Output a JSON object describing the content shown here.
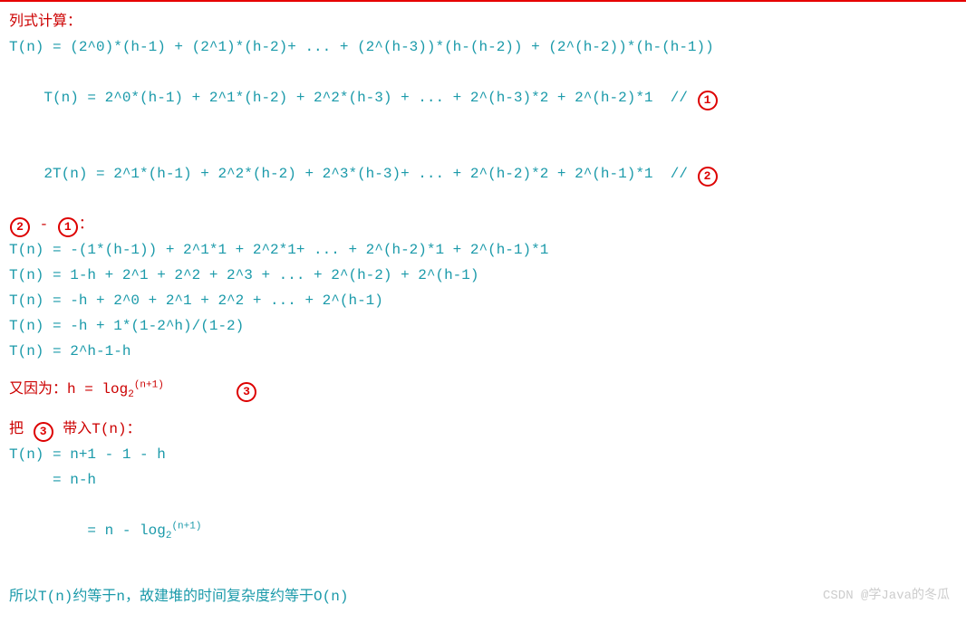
{
  "heading": "列式计算：",
  "eq1": "T(n) = (2^0)*(h-1) + (2^1)*(h-2)+ ... + (2^(h-3))*(h-(h-2)) + (2^(h-2))*(h-(h-1))",
  "eq2": "T(n) = 2^0*(h-1) + 2^1*(h-2) + 2^2*(h-3) + ... + 2^(h-3)*2 + 2^(h-2)*1  // ",
  "eq3": "2T(n) = 2^1*(h-1) + 2^2*(h-2) + 2^3*(h-3)+ ... + 2^(h-2)*2 + 2^(h-1)*1  // ",
  "circ1": "1",
  "circ2": "2",
  "circ3": "3",
  "minus_label_prefix": "",
  "minus_label_mid": " - ",
  "minus_label_suffix": "：",
  "eq4": "T(n) = -(1*(h-1)) + 2^1*1 + 2^2*1+ ... + 2^(h-2)*1 + 2^(h-1)*1",
  "eq5": "T(n) = 1-h + 2^1 + 2^2 + 2^3 + ... + 2^(h-2) + 2^(h-1)",
  "eq6": "T(n) = -h + 2^0 + 2^1 + 2^2 + ... + 2^(h-1)",
  "eq7": "T(n) = -h + 1*(1-2^h)/(1-2)",
  "eq8": "T(n) = 2^h-1-h",
  "because_prefix": "又因为：h = log",
  "because_base": "2",
  "because_arg": "(n+1)",
  "sub_heading_prefix": "把 ",
  "sub_heading_suffix": " 带入T(n)：",
  "res1": "T(n) = n+1 - 1 - h",
  "res2": "     = n-h",
  "res3_prefix": "     = n - log",
  "res3_base": "2",
  "res3_arg": "(n+1)",
  "conclusion": "所以T(n)约等于n，故建堆的时间复杂度约等于O(n)",
  "watermark": "CSDN @学Java的冬瓜"
}
